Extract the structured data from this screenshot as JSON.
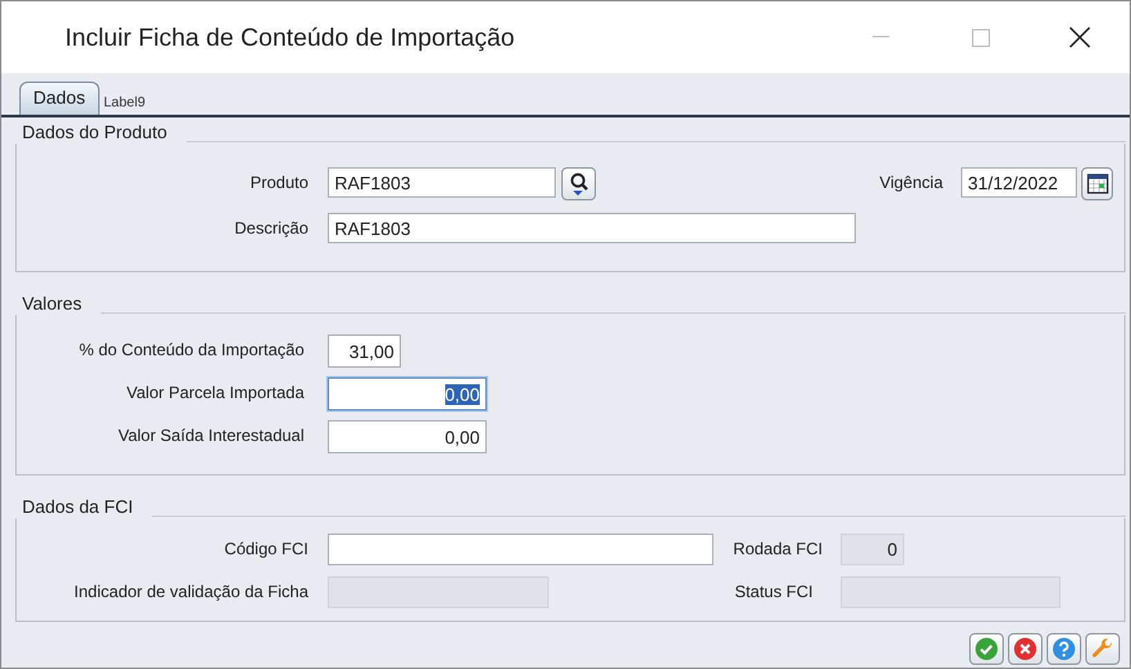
{
  "window": {
    "title": "Incluir Ficha de Conteúdo de Importação"
  },
  "tabs": [
    {
      "label": "Dados",
      "selected": true
    }
  ],
  "overlay_label": "Label9",
  "sections": [
    {
      "title": "Dados do Produto",
      "rows": [
        [
          {
            "label": "Produto",
            "value": "RAF1803",
            "kind": "lookup",
            "disabled": false,
            "focused": false
          },
          {
            "label": "Vigência",
            "value": "31/12/2022",
            "kind": "date",
            "disabled": false,
            "focused": false
          }
        ],
        [
          {
            "label": "Descrição",
            "value": "RAF1803",
            "kind": "text",
            "disabled": false,
            "focused": false
          }
        ]
      ]
    },
    {
      "title": "Valores",
      "rows": [
        [
          {
            "label": "% do Conteúdo da Importação",
            "value": "31,00",
            "kind": "number",
            "disabled": false,
            "focused": false
          }
        ],
        [
          {
            "label": "Valor Parcela Importada",
            "value": "0,00",
            "kind": "number",
            "disabled": false,
            "focused": true
          }
        ],
        [
          {
            "label": "Valor Saída Interestadual",
            "value": "0,00",
            "kind": "number",
            "disabled": false,
            "focused": false
          }
        ]
      ]
    },
    {
      "title": "Dados da FCI",
      "rows": [
        [
          {
            "label": "Código FCI",
            "kind": "text",
            "disabled": false,
            "focused": false
          },
          {
            "label": "Rodada FCI",
            "value": "0",
            "kind": "number",
            "disabled": true,
            "focused": false
          }
        ],
        [
          {
            "label": "Indicador de validação da Ficha",
            "kind": "text",
            "disabled": true,
            "focused": false
          },
          {
            "label": "Status FCI",
            "kind": "text",
            "disabled": true,
            "focused": false
          }
        ]
      ]
    }
  ],
  "footer_buttons": [
    {
      "kind": "confirm"
    },
    {
      "kind": "cancel"
    },
    {
      "kind": "help"
    },
    {
      "kind": "settings"
    }
  ]
}
